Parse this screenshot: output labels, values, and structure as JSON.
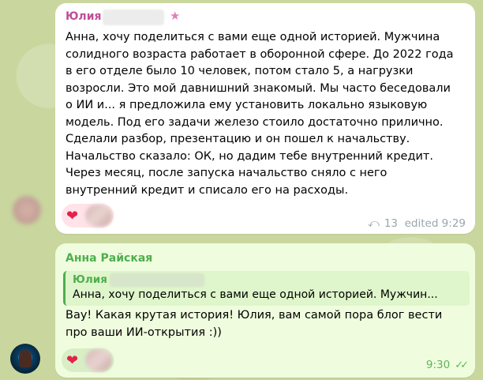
{
  "message1": {
    "sender": "Юлия",
    "text": "Анна, хочу поделиться с вами еще одной историей. Мужчина\nсолидного возраста работает в оборонной сфере. До 2022 года\nв его отделе было 10 человек, потом стало 5, а нагрузки\nвозросли. Это мой давнишний знакомый. Мы часто беседовали\nо ИИ и... я предложила ему установить локально языковую\nмодель. Под его задачи железо стоило достаточно прилично.\nСделали разбор, презентацию и он пошел к начальству.\nНачальство сказало: ОК, но дадим тебе внутренний кредит.\nЧерез месяц, после запуска начальство сняло с него\nвнутренний кредит и списало его на расходы.",
    "reaction_emoji": "❤",
    "forward_count": "13",
    "status": "edited 9:29",
    "forward_icon": "reply-share-icon"
  },
  "message2": {
    "sender": "Анна Райская",
    "quote_sender": "Юлия",
    "quote_text": "Анна, хочу поделиться с вами еще одной историей. Мужчин...",
    "text": "Вау! Какая крутая история! Юлия, вам самой пора блог вести\nпро ваши ИИ-открытия :))",
    "reaction_emoji": "❤",
    "time": "9:30",
    "read_icon": "double-check-icon"
  },
  "colors": {
    "sender1": "#c14e98",
    "sender2": "#4fae4e",
    "incoming_bubble": "#ffffff",
    "outgoing_bubble": "#effdde",
    "background": "#c9d79f"
  }
}
